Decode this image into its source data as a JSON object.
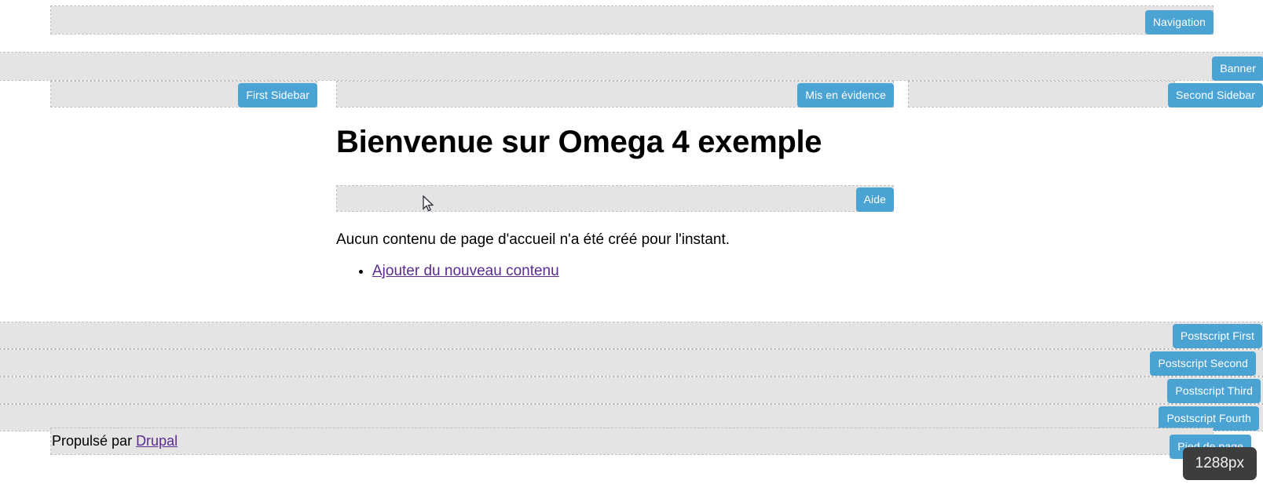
{
  "page": {
    "title": "Bienvenue sur Omega 4 exemple",
    "body_text": "Aucun contenu de page d'accueil n'a été créé pour l'instant.",
    "list_items": [
      {
        "label": "Ajouter du nouveau contenu"
      }
    ]
  },
  "regions": {
    "navigation": {
      "label": "Navigation"
    },
    "banner": {
      "label": "Banner"
    },
    "sidebar_first": {
      "label": "First Sidebar"
    },
    "featured": {
      "label": "Mis en évidence"
    },
    "sidebar_second": {
      "label": "Second Sidebar"
    },
    "help": {
      "label": "Aide"
    },
    "postscript_first": {
      "label": "Postscript First"
    },
    "postscript_second": {
      "label": "Postscript Second"
    },
    "postscript_third": {
      "label": "Postscript Third"
    },
    "postscript_fourth": {
      "label": "Postscript Fourth"
    },
    "footer": {
      "label": "Pied de page"
    }
  },
  "footer": {
    "prefix": "Propulsé par ",
    "link_label": "Drupal"
  },
  "viewport": {
    "width_label": "1288px"
  },
  "colors": {
    "region_label_blue": "#4ba3d3",
    "region_background": "#e4e4e4",
    "region_border": "#bfbfbf",
    "link_purple": "#5b2a92",
    "viewport_badge": "#3d3d3d"
  },
  "icons": {
    "cursor": "arrow-pointer-icon"
  }
}
